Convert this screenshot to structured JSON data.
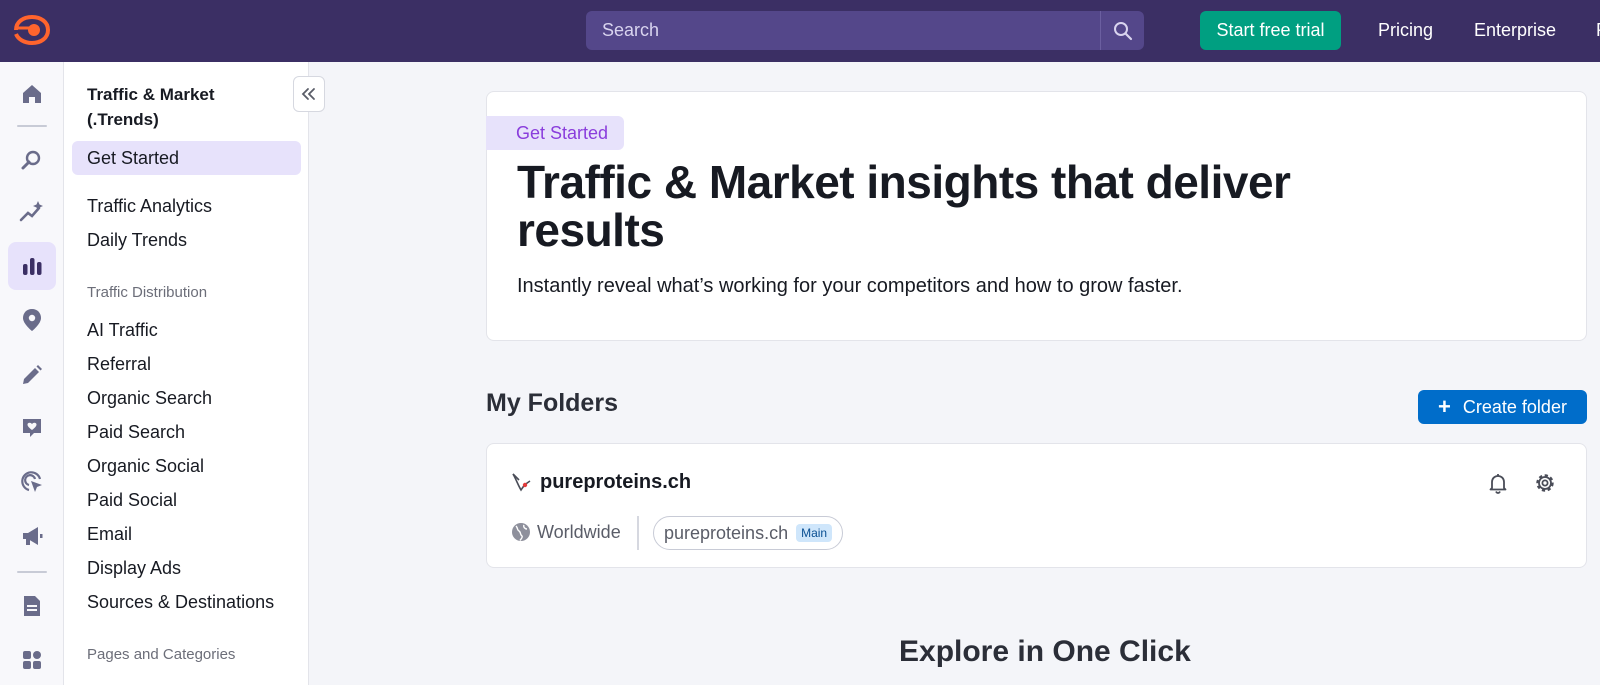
{
  "header": {
    "logo_label": "Semrush",
    "search_placeholder": "Search",
    "trial_label": "Start free trial",
    "pricing_label": "Pricing",
    "enterprise_label": "Enterprise",
    "colors": {
      "bar": "#3b2f64",
      "trial": "#009f81",
      "accent": "#ff642d"
    }
  },
  "rail": {
    "icons": [
      "home-icon",
      "seo-icon",
      "ai-sparkle-icon",
      "bar-chart-icon",
      "location-pin-icon",
      "pencil-icon",
      "heart-message-icon",
      "cursor-target-icon",
      "megaphone-icon",
      "report-document-icon",
      "apps-grid-icon"
    ],
    "active": "bar-chart-icon"
  },
  "subnav": {
    "title": "Traffic & Market (.Trends)",
    "items_top": [
      "Get Started",
      "Traffic Analytics",
      "Daily Trends"
    ],
    "section_distribution": "Traffic Distribution",
    "items_distribution": [
      "AI Traffic",
      "Referral",
      "Organic Search",
      "Paid Search",
      "Organic Social",
      "Paid Social",
      "Email",
      "Display Ads",
      "Sources & Destinations"
    ],
    "section_pages": "Pages and Categories"
  },
  "hero": {
    "badge": "Get Started",
    "title": "Traffic & Market insights that deliver results",
    "subtitle": "Instantly reveal what’s working for your competitors and how to grow faster."
  },
  "folders": {
    "title": "My Folders",
    "create_label": "Create folder",
    "items": [
      {
        "name": "pureproteins.ch",
        "region": "Worldwide",
        "domain": "pureproteins.ch",
        "badge": "Main"
      }
    ]
  },
  "explore": {
    "title": "Explore in One Click"
  }
}
